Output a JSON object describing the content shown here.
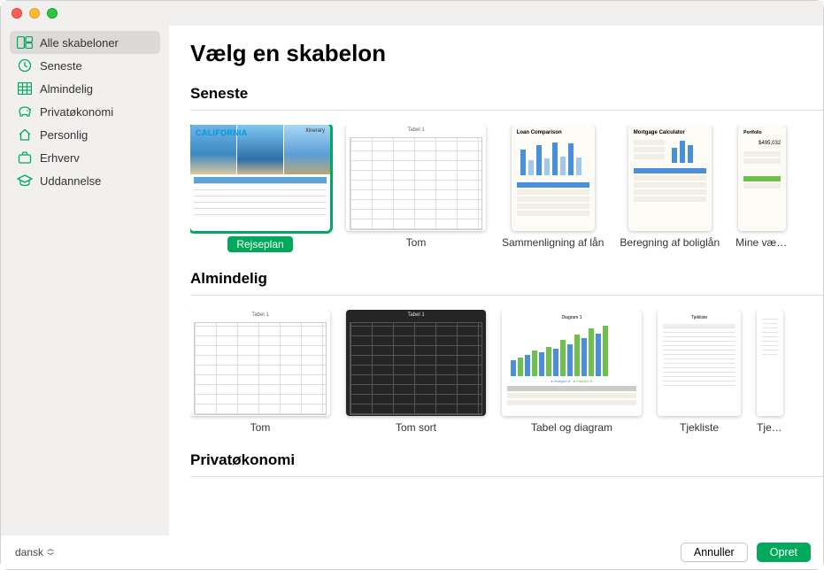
{
  "window": {
    "title": "Vælg en skabelon"
  },
  "sidebar": {
    "items": [
      {
        "icon": "templates-icon",
        "label": "Alle skabeloner",
        "selected": true
      },
      {
        "icon": "clock-icon",
        "label": "Seneste",
        "selected": false
      },
      {
        "icon": "grid-icon",
        "label": "Almindelig",
        "selected": false
      },
      {
        "icon": "piggy-icon",
        "label": "Privatøkonomi",
        "selected": false
      },
      {
        "icon": "house-icon",
        "label": "Personlig",
        "selected": false
      },
      {
        "icon": "briefcase-icon",
        "label": "Erhverv",
        "selected": false
      },
      {
        "icon": "gradcap-icon",
        "label": "Uddannelse",
        "selected": false
      }
    ]
  },
  "sections": {
    "seneste": {
      "title": "Seneste",
      "templates": [
        {
          "label": "Rejseplan",
          "selected": true,
          "kind": "rejse",
          "headline": "CALIFORNIA",
          "sub": "Itinerary"
        },
        {
          "label": "Tom",
          "selected": false,
          "kind": "tom"
        },
        {
          "label": "Sammenligning af lån",
          "selected": false,
          "kind": "loan",
          "doc_title": "Loan Comparison"
        },
        {
          "label": "Beregning af boliglån",
          "selected": false,
          "kind": "mortgage",
          "doc_title": "Mortgage Calculator"
        },
        {
          "label": "Mine værdier",
          "selected": false,
          "kind": "portfolio",
          "doc_title": "Portfolio"
        }
      ]
    },
    "almindelig": {
      "title": "Almindelig",
      "templates": [
        {
          "label": "Tom",
          "selected": false,
          "kind": "tom"
        },
        {
          "label": "Tom sort",
          "selected": false,
          "kind": "tom-sort"
        },
        {
          "label": "Tabel og diagram",
          "selected": false,
          "kind": "tabel-diagram"
        },
        {
          "label": "Tjekliste",
          "selected": false,
          "kind": "tjekliste"
        },
        {
          "label": "Tjekliste",
          "selected": false,
          "kind": "tjekliste-cut"
        }
      ]
    },
    "privat": {
      "title": "Privatøkonomi"
    }
  },
  "footer": {
    "language": "dansk",
    "cancel_label": "Annuller",
    "create_label": "Opret"
  },
  "colors": {
    "accent": "#00a95c"
  }
}
